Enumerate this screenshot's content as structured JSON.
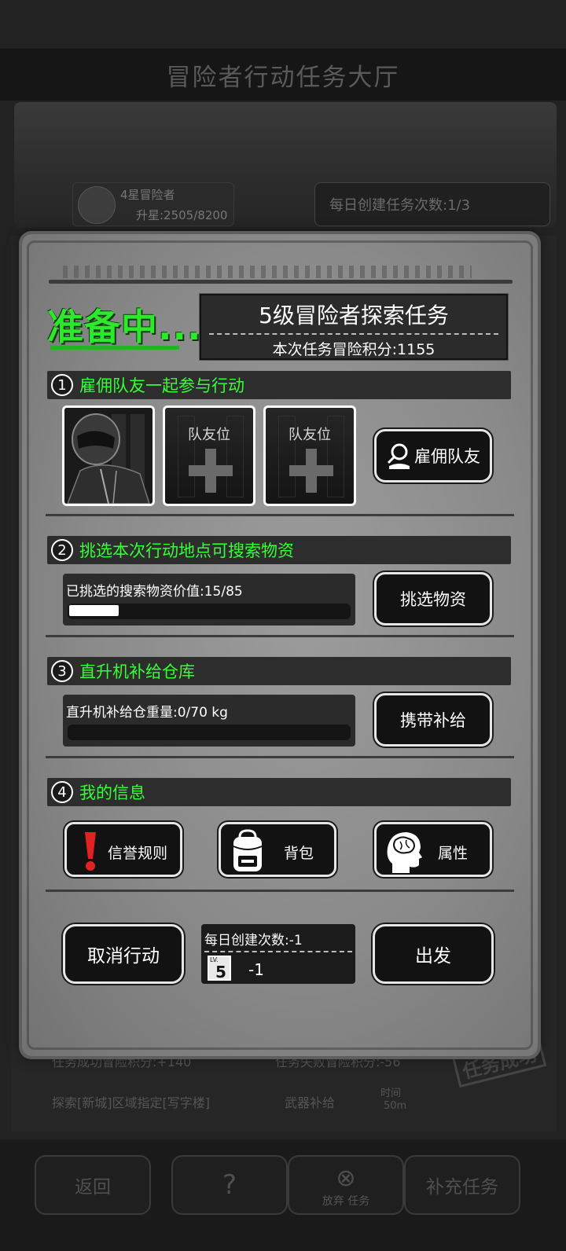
{
  "background": {
    "header_title": "冒险者行动任务大厅",
    "rank_title": "4星冒险者",
    "rank_progress": "升星:2505/8200",
    "daily_tasks": "每日创建任务次数:1/3",
    "footer_success": "任务成功冒险积分:+140",
    "footer_fail": "任务失败冒险积分:-56",
    "footer_task": "探索[新城]区域指定[写字楼]",
    "footer_reward": "武器补给",
    "footer_time_label": "时间",
    "footer_time": "50m",
    "stamp": "任务成功",
    "bottom_buttons": [
      "返回",
      "",
      "补充任务"
    ],
    "abandon_label": "放弃 任务"
  },
  "dialog": {
    "status": "准备中...",
    "mission_title": "5级冒险者探索任务",
    "mission_score": "本次任务冒险积分:1155",
    "section1": {
      "num": "1",
      "title": "雇佣队友一起参与行动"
    },
    "slot_label": "队友位",
    "hire_button": "雇佣队友",
    "section2": {
      "num": "2",
      "title": "挑选本次行动地点可搜索物资"
    },
    "supplies_value": "已挑选的搜索物资价值:15/85",
    "supplies_progress": 0.176,
    "select_button": "挑选物资",
    "section3": {
      "num": "3",
      "title": "直升机补给仓库"
    },
    "warehouse_weight": "直升机补给仓重量:0/70 kg",
    "warehouse_progress": 0,
    "carry_button": "携带补给",
    "section4": {
      "num": "4",
      "title": "我的信息"
    },
    "info_buttons": {
      "reputation": "信誉规则",
      "backpack": "背包",
      "attributes": "属性"
    },
    "cancel_button": "取消行动",
    "daily_create": "每日创建次数:-1",
    "level_badge_small": "LV.",
    "level_badge": "5",
    "level_cost": "-1",
    "depart_button": "出发"
  }
}
